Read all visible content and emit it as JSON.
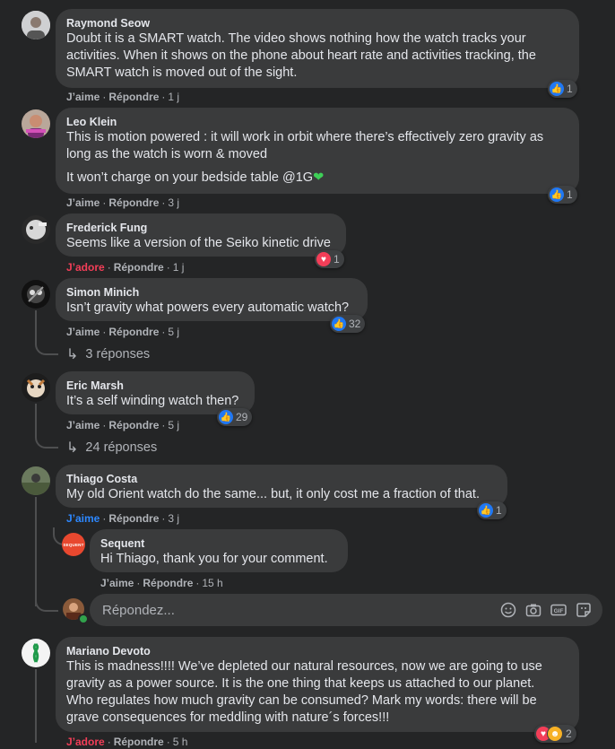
{
  "actions": {
    "like": "J’aime",
    "reply": "Répondre",
    "love": "J’adore"
  },
  "comments": [
    {
      "author": "Raymond Seow",
      "text": [
        "Doubt it is a SMART watch. The video shows nothing how the watch tracks your",
        "activities. When it shows on the phone about heart rate and activities tracking, the",
        "SMART watch is moved out of the sight."
      ],
      "time": "1 j",
      "reactions": "1"
    },
    {
      "author": "Leo Klein",
      "text": [
        "This is motion powered : it will work in orbit where there’s effectively zero gravity as",
        "long as the watch is worn & moved"
      ],
      "text2": "It won’t charge on your bedside table @1G",
      "time": "3 j",
      "reactions": "1"
    },
    {
      "author": "Frederick Fung",
      "text": [
        "Seems like a version of the Seiko kinetic drive"
      ],
      "time": "1 j",
      "reactions": "1"
    },
    {
      "author": "Simon Minich",
      "text": [
        "Isn’t gravity what powers every automatic watch?"
      ],
      "time": "5 j",
      "reactions": "32",
      "replies": "3 réponses"
    },
    {
      "author": "Eric Marsh",
      "text": [
        "It’s a self winding watch then?"
      ],
      "time": "5 j",
      "reactions": "29",
      "replies": "24 réponses"
    },
    {
      "author": "Thiago Costa",
      "text": [
        "My old Orient watch do the same... but, it only cost me a fraction of that."
      ],
      "time": "3 j",
      "reactions": "1"
    },
    {
      "author": "Sequent",
      "text": [
        "Hi Thiago, thank you for your comment."
      ],
      "time": "15 h"
    },
    {
      "author": "Mariano Devoto",
      "text": [
        "This is madness!!!! We’ve depleted our natural resources, now we are going to use",
        "gravity as a power source. It is the one thing that keeps us attached to our planet.",
        "Who regulates how much gravity can be consumed? Mark my words: there will be",
        "grave consequences for meddling with nature´s forces!!!"
      ],
      "time": "5 h",
      "reactions": "2"
    }
  ],
  "reply_box": {
    "placeholder": "Répondez..."
  },
  "sequent_logo_text": "SEQUENT",
  "colors": {
    "like": "#2078f4",
    "love": "#f33e58",
    "haha": "#f7b125",
    "background": "#242526",
    "bubble": "#3a3b3c"
  },
  "icons": [
    "like-icon",
    "love-icon",
    "haha-icon",
    "green-heart-emoji",
    "reply-arrow-icon",
    "emoji-icon",
    "camera-icon",
    "gif-icon",
    "sticker-icon"
  ]
}
